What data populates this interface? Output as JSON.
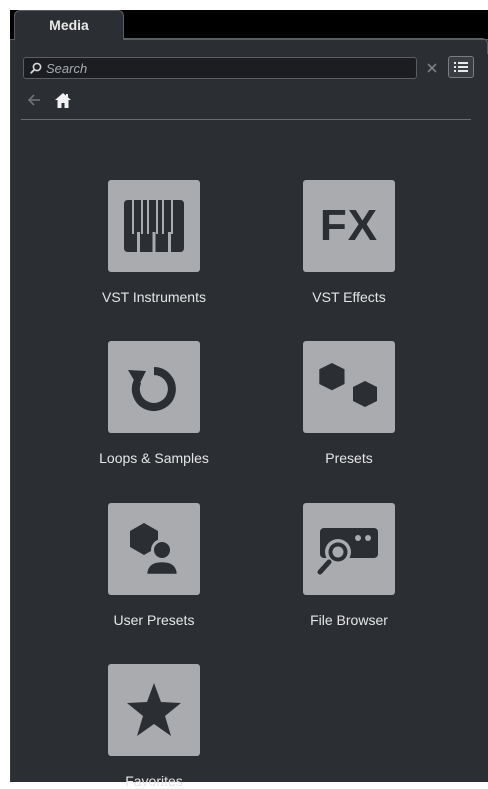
{
  "tab": {
    "label": "Media"
  },
  "search": {
    "placeholder": "Search"
  },
  "tiles": [
    {
      "label": "VST Instruments",
      "icon": "piano-keys-icon"
    },
    {
      "label": "VST Effects",
      "icon": "fx-icon",
      "icon_text": "FX"
    },
    {
      "label": "Loops & Samples",
      "icon": "loop-arrow-icon"
    },
    {
      "label": "Presets",
      "icon": "hexagons-icon"
    },
    {
      "label": "User Presets",
      "icon": "user-hexagon-icon"
    },
    {
      "label": "File Browser",
      "icon": "folder-search-icon"
    },
    {
      "label": "Favorites",
      "icon": "star-icon"
    }
  ],
  "colors": {
    "panel": "#2b2e32",
    "icon_bg": "#a9abae",
    "icon_fg": "#2b2e32",
    "text": "#e6e6e6"
  }
}
